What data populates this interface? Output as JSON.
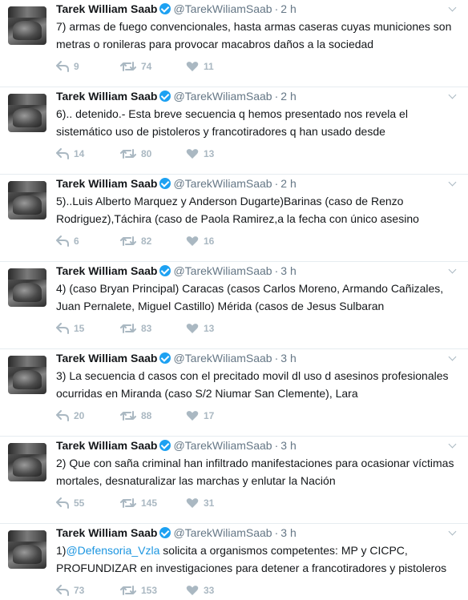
{
  "colors": {
    "name": "#14171a",
    "meta": "#657786",
    "icon": "#aab8c2",
    "verified": "#1da1f2",
    "link": "#1b95e0",
    "divider": "#e6ecf0"
  },
  "icons": {
    "reply": "reply-icon",
    "retweet": "retweet-icon",
    "like": "heart-icon",
    "verified": "verified-badge-icon",
    "menu": "chevron-down-icon"
  },
  "tweets": [
    {
      "name": "Tarek William Saab",
      "handle": "@TarekWiliamSaab",
      "sep": "·",
      "time": "2 h",
      "mention": "",
      "text": "7) armas de fuego convencionales, hasta armas caseras cuyas municiones son metras o ronileras para provocar macabros daños a la sociedad",
      "replies": "9",
      "retweets": "74",
      "likes": "11"
    },
    {
      "name": "Tarek William Saab",
      "handle": "@TarekWiliamSaab",
      "sep": "·",
      "time": "2 h",
      "mention": "",
      "text": "6).. detenido.- Esta breve secuencia q hemos presentado nos revela el sistemático uso de pistoleros y francotiradores q han usado desde",
      "replies": "14",
      "retweets": "80",
      "likes": "13"
    },
    {
      "name": "Tarek William Saab",
      "handle": "@TarekWiliamSaab",
      "sep": "·",
      "time": "2 h",
      "mention": "",
      "text": "5)..Luis Alberto Marquez y Anderson Dugarte)Barinas (caso de Renzo Rodriguez),Táchira (caso de Paola Ramirez,a la fecha con único asesino",
      "replies": "6",
      "retweets": "82",
      "likes": "16"
    },
    {
      "name": "Tarek William Saab",
      "handle": "@TarekWiliamSaab",
      "sep": "·",
      "time": "3 h",
      "mention": "",
      "text": "4) (caso Bryan Principal) Caracas (casos Carlos Moreno, Armando Cañizales, Juan Pernalete, Miguel Castillo) Mérida (casos de Jesus Sulbaran",
      "replies": "15",
      "retweets": "83",
      "likes": "13"
    },
    {
      "name": "Tarek William Saab",
      "handle": "@TarekWiliamSaab",
      "sep": "·",
      "time": "3 h",
      "mention": "",
      "text": "3) La secuencia d casos con el precitado movil dl uso d asesinos profesionales ocurridas en Miranda (caso S/2 Niumar San Clemente), Lara",
      "replies": "20",
      "retweets": "88",
      "likes": "17"
    },
    {
      "name": "Tarek William Saab",
      "handle": "@TarekWiliamSaab",
      "sep": "·",
      "time": "3 h",
      "mention": "",
      "text": "2) Que con saña criminal han infiltrado manifestaciones para ocasionar víctimas mortales, desnaturalizar las marchas y enlutar la Nación",
      "replies": "55",
      "retweets": "145",
      "likes": "31"
    },
    {
      "name": "Tarek William Saab",
      "handle": "@TarekWiliamSaab",
      "sep": "·",
      "time": "3 h",
      "prefix": "1)",
      "mention": "@Defensoria_Vzla",
      "text": " solicita a organismos competentes: MP y CICPC, PROFUNDIZAR en investigaciones para detener a francotiradores y pistoleros",
      "replies": "73",
      "retweets": "153",
      "likes": "33"
    }
  ]
}
